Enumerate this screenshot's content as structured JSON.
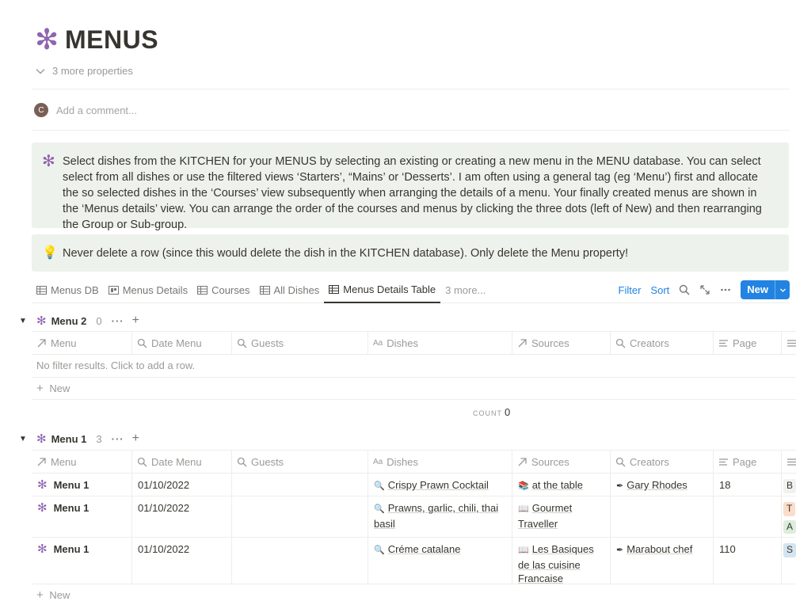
{
  "page": {
    "title": "MENUS",
    "more_properties": "3 more properties",
    "comment_avatar": "C",
    "comment_placeholder": "Add a comment..."
  },
  "callouts": [
    {
      "text": "Select dishes from the KITCHEN for your MENUS by selecting an existing or creating a new menu in the MENU database. You can select select from all dishes or use the filtered views ‘Starters’, “Mains’ or ‘Desserts’.  I am often using a general tag (eg ‘Menu’) first and allocate the so selected dishes in the ‘Courses’ view subsequently when arranging the details of a menu. Your finally created menus are shown in the ‘Menus details’ view. You can arrange the order of the courses and menus by clicking the three dots (left of New) and then rearranging the Group or Sub-group."
    },
    {
      "icon": "💡",
      "text": "Never delete a row (since this would delete the dish in the KITCHEN database). Only delete the Menu property!"
    }
  ],
  "views": {
    "tabs": [
      "Menus DB",
      "Menus Details",
      "Courses",
      "All Dishes",
      "Menus Details Table"
    ],
    "more": "3 more...",
    "filter": "Filter",
    "sort": "Sort",
    "new": "New"
  },
  "columns": [
    "Menu",
    "Date Menu",
    "Guests",
    "Dishes",
    "Sources",
    "Creators",
    "Page"
  ],
  "groups": [
    {
      "name": "Menu 2",
      "count": "0",
      "empty_text": "No filter results. Click to add a row.",
      "new_label": "New",
      "count_label": "COUNT",
      "count_value": "0"
    },
    {
      "name": "Menu 1",
      "count": "3",
      "new_label": "New",
      "rows": [
        {
          "menu": "Menu 1",
          "date": "01/10/2022",
          "guests": "",
          "dish": "Crispy Prawn Cocktail",
          "source": "at the table",
          "creator": "Gary Rhodes",
          "page": "18",
          "extra": "B"
        },
        {
          "menu": "Menu 1",
          "date": "01/10/2022",
          "guests": "",
          "dish": "Prawns, garlic, chili, thai basil",
          "source": "Gourmet Traveller",
          "creator": "",
          "page": "",
          "extra": "T",
          "extra2": "A"
        },
        {
          "menu": "Menu 1",
          "date": "01/10/2022",
          "guests": "",
          "dish": "Créme catalane",
          "source": "Les Basiques de las cuisine Francaise",
          "creator": "Marabout chef",
          "page": "110",
          "extra": "S"
        }
      ]
    }
  ],
  "colors": {
    "accent": "#2383e2",
    "asterisk": "#9065b0",
    "callout_bg": "#edf3ec"
  }
}
